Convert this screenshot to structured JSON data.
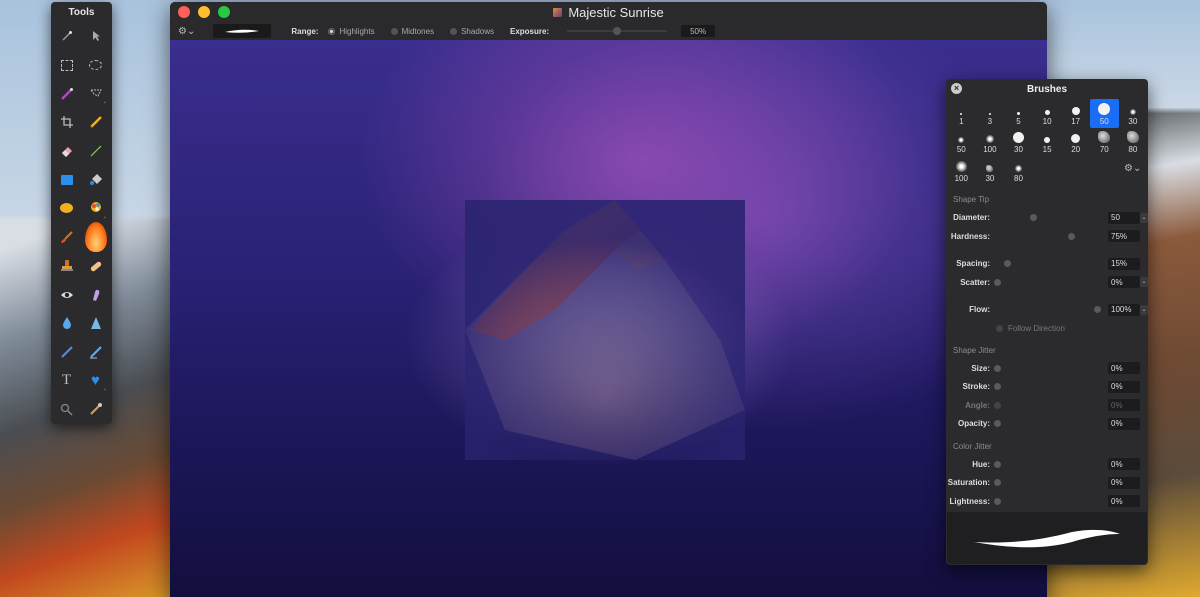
{
  "window": {
    "title": "Majestic Sunrise"
  },
  "toolbar": {
    "range_label": "Range:",
    "range_options": [
      {
        "label": "Highlights",
        "selected": true
      },
      {
        "label": "Midtones",
        "selected": false
      },
      {
        "label": "Shadows",
        "selected": false
      }
    ],
    "exposure_label": "Exposure:",
    "exposure_value": "50%",
    "exposure_fraction": 0.5
  },
  "tools": {
    "title": "Tools",
    "items": [
      {
        "icon": "magic-wand-icon"
      },
      {
        "icon": "pointer-arrow-icon"
      },
      {
        "icon": "rect-select-icon"
      },
      {
        "icon": "ellipse-select-icon"
      },
      {
        "icon": "selection-brush-icon"
      },
      {
        "icon": "lasso-icon"
      },
      {
        "icon": "crop-icon"
      },
      {
        "icon": "pencil-icon"
      },
      {
        "icon": "eraser-icon"
      },
      {
        "icon": "line-icon"
      },
      {
        "icon": "rectangle-shape-icon"
      },
      {
        "icon": "paint-bucket-icon"
      },
      {
        "icon": "ellipse-shape-icon"
      },
      {
        "icon": "color-picker-icon"
      },
      {
        "icon": "brush-icon"
      },
      {
        "icon": "burn-flame-icon"
      },
      {
        "icon": "clone-stamp-icon"
      },
      {
        "icon": "bandage-heal-icon"
      },
      {
        "icon": "red-eye-icon"
      },
      {
        "icon": "smudge-icon"
      },
      {
        "icon": "blur-drop-icon"
      },
      {
        "icon": "sharpen-cone-icon"
      },
      {
        "icon": "pen-icon"
      },
      {
        "icon": "freeform-pen-icon"
      },
      {
        "icon": "text-icon"
      },
      {
        "icon": "heart-shape-icon"
      },
      {
        "icon": "zoom-icon"
      },
      {
        "icon": "eyedropper-icon"
      }
    ]
  },
  "brushes": {
    "title": "Brushes",
    "presets": [
      {
        "size": "1",
        "selected": false
      },
      {
        "size": "3",
        "selected": false
      },
      {
        "size": "5",
        "selected": false
      },
      {
        "size": "10",
        "selected": false
      },
      {
        "size": "17",
        "selected": false
      },
      {
        "size": "50",
        "selected": true
      },
      {
        "size": "30",
        "selected": false
      },
      {
        "size": "50",
        "selected": false
      },
      {
        "size": "100",
        "selected": false
      },
      {
        "size": "30",
        "selected": false
      },
      {
        "size": "15",
        "selected": false
      },
      {
        "size": "20",
        "selected": false
      },
      {
        "size": "70",
        "selected": false
      },
      {
        "size": "80",
        "selected": false
      },
      {
        "size": "100",
        "selected": false
      },
      {
        "size": "30",
        "selected": false
      },
      {
        "size": "80",
        "selected": false
      }
    ],
    "shape_tip": {
      "heading": "Shape Tip",
      "diameter": {
        "label": "Diameter:",
        "value": "50"
      },
      "hardness": {
        "label": "Hardness:",
        "value": "75%"
      },
      "spacing": {
        "label": "Spacing:",
        "value": "15%"
      },
      "scatter": {
        "label": "Scatter:",
        "value": "0%"
      },
      "flow": {
        "label": "Flow:",
        "value": "100%"
      },
      "follow_direction": "Follow Direction"
    },
    "shape_jitter": {
      "heading": "Shape Jitter",
      "size": {
        "label": "Size:",
        "value": "0%"
      },
      "stroke": {
        "label": "Stroke:",
        "value": "0%"
      },
      "angle": {
        "label": "Angle:",
        "value": "0%"
      },
      "opacity": {
        "label": "Opacity:",
        "value": "0%"
      }
    },
    "color_jitter": {
      "heading": "Color Jitter",
      "hue": {
        "label": "Hue:",
        "value": "0%"
      },
      "saturation": {
        "label": "Saturation:",
        "value": "0%"
      },
      "lightness": {
        "label": "Lightness:",
        "value": "0%"
      }
    }
  },
  "colors": {
    "accent": "#1a6ef5",
    "close": "#fe5f57",
    "minimize": "#febc2e",
    "maximize": "#28c840"
  }
}
